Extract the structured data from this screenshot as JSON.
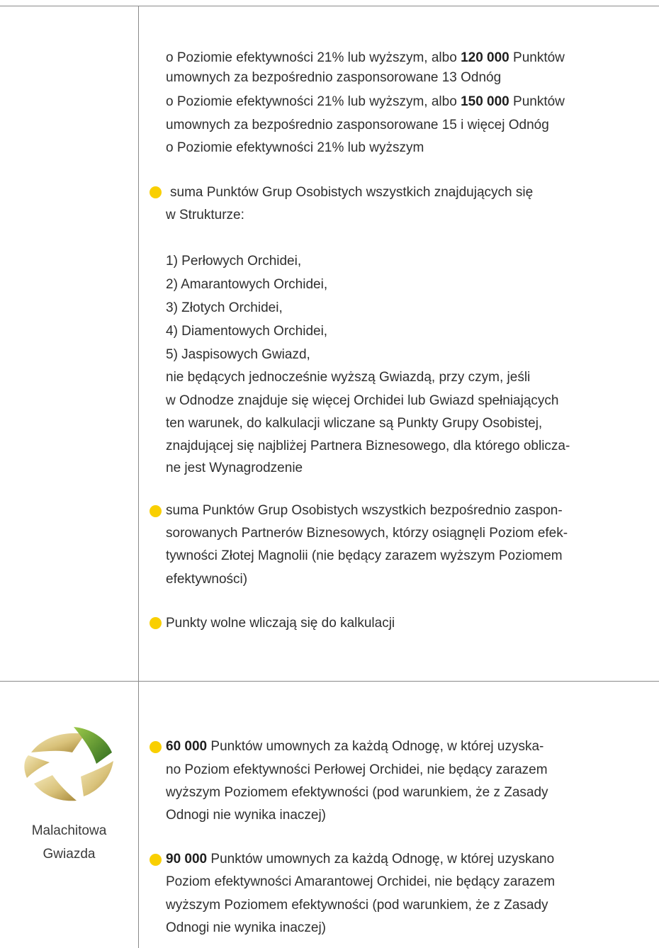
{
  "row1": {
    "intro_lines": [
      {
        "pre": "o Poziomie efektywności 21% lub wyższym, albo ",
        "bold": "120 000",
        "post": " Punktów"
      },
      {
        "text": "umownych za bezpośrednio zasponsorowane 13 Odnóg"
      },
      {
        "pre": "o Poziomie efektywności 21% lub wyższym, albo ",
        "bold": "150 000",
        "post": " Punktów"
      },
      {
        "text": "umownych za bezpośrednio zasponsorowane 15 i więcej Odnóg"
      },
      {
        "text": "o Poziomie efektywności 21% lub wyższym"
      }
    ],
    "bullet_structure": {
      "lines": [
        "suma Punktów Grup Osobistych wszystkich znajdujących się",
        "w Strukturze:"
      ],
      "items": [
        "1) Perłowych Orchidei,",
        "2) Amarantowych Orchidei,",
        "3) Złotych Orchidei,",
        "4) Diamentowych Orchidei,",
        "5) Jaspisowych Gwiazd,"
      ],
      "tail": [
        "nie będących jednocześnie wyższą Gwiazdą, przy czym, jeśli",
        "w Odnodze znajduje się więcej Orchidei lub Gwiazd spełniających",
        "ten warunek, do kalkulacji wliczane są Punkty Grupy Osobistej,",
        "znajdującej się najbliżej Partnera Biznesowego, dla którego oblicza-",
        "ne jest Wynagrodzenie"
      ]
    },
    "bullet_sponsored": [
      "suma Punktów Grup Osobistych wszystkich bezpośrednio zaspon-",
      "sorowanych Partnerów Biznesowych, którzy osiągnęli Poziom efek-",
      "tywności Złotej Magnolii (nie będący zarazem wyższym Poziomem",
      "efektywności)"
    ],
    "bullet_free": "Punkty wolne wliczają się do kalkulacji"
  },
  "row2": {
    "level_name_line1": "Malachitowa",
    "level_name_line2": "Gwiazda",
    "bullet_a": {
      "bold": "60 000",
      "first_line_rest": " Punktów umownych za każdą Odnogę, w której uzyska-",
      "lines": [
        "no Poziom efektywności Perłowej Orchidei, nie będący zarazem",
        "wyższym Poziomem efektywności (pod warunkiem, że z Zasady",
        "Odnogi nie wynika inaczej)"
      ]
    },
    "bullet_b": {
      "bold": "90 000",
      "first_line_rest": " Punktów umownych za każdą Odnogę, w której uzyskano",
      "lines": [
        "Poziom efektywności Amarantowej Orchidei, nie będący zarazem",
        "wyższym Poziomem efektywności (pod warunkiem, że z Zasady",
        "Odnogi nie wynika inaczej)"
      ]
    }
  },
  "colors": {
    "bullet": "#f9cf00",
    "grid": "#8a8a8a",
    "emblem_gold": "#d9c27a",
    "emblem_green": "#4e8a2c"
  },
  "icons": {
    "level_emblem": "malachite-star-emblem-icon",
    "bullet": "yellow-dot-icon"
  }
}
